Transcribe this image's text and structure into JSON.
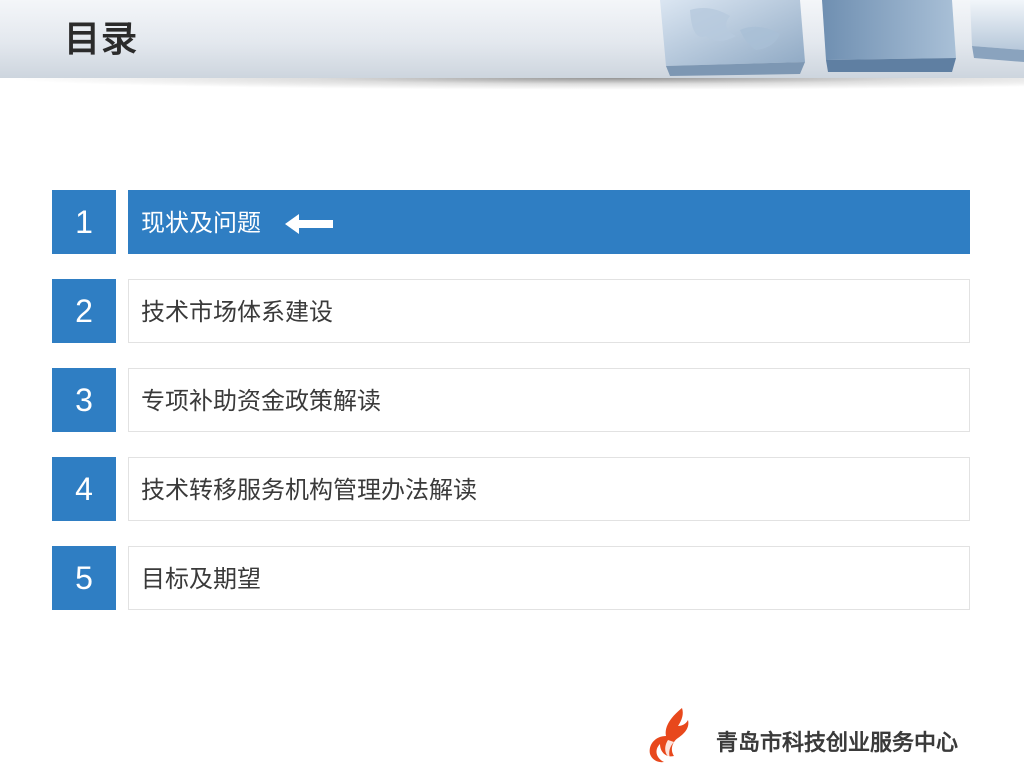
{
  "slide": {
    "title": "目录"
  },
  "toc": {
    "items": [
      {
        "number": "1",
        "label": "现状及问题",
        "active": true
      },
      {
        "number": "2",
        "label": "技术市场体系建设",
        "active": false
      },
      {
        "number": "3",
        "label": "专项补助资金政策解读",
        "active": false
      },
      {
        "number": "4",
        "label": "技术转移服务机构管理办法解读",
        "active": false
      },
      {
        "number": "5",
        "label": "目标及期望",
        "active": false
      }
    ]
  },
  "footer": {
    "org_name": "青岛市科技创业服务中心"
  },
  "colors": {
    "accent": "#2f7ec3",
    "logo": "#e8481c",
    "text": "#3a3a3a"
  },
  "icons": {
    "current_marker": "arrow-left-icon",
    "org_logo": "flame-logo-icon",
    "header_decoration": "cubes-globe-image"
  }
}
